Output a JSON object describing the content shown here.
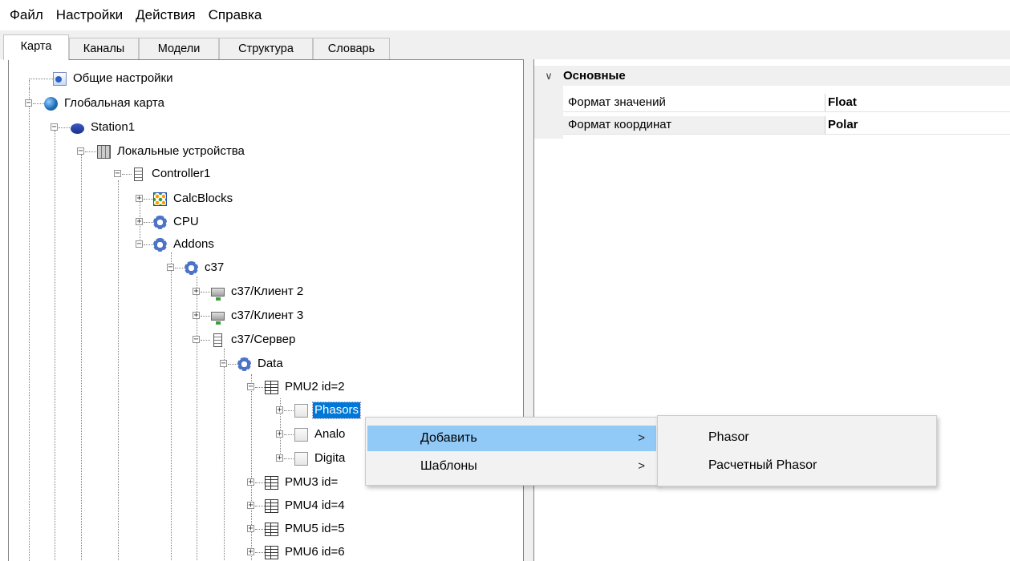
{
  "menubar": {
    "items": [
      "Файл",
      "Настройки",
      "Действия",
      "Справка"
    ]
  },
  "tabs": [
    "Карта",
    "Каналы",
    "Модели",
    "Структура",
    "Словарь"
  ],
  "tree": {
    "general_settings": "Общие настройки",
    "global_map": "Глобальная карта",
    "station1": "Station1",
    "local_devices": "Локальные устройства",
    "controller1": "Controller1",
    "calcblocks": "CalcBlocks",
    "cpu": "CPU",
    "addons": "Addons",
    "c37": "c37",
    "client2": "c37/Клиент 2",
    "client3": "c37/Клиент 3",
    "server": "c37/Сервер",
    "data": "Data",
    "pmu2": "PMU2 id=2",
    "phasors": "Phasors",
    "analog": "Analo",
    "digital": "Digita",
    "pmu3": "PMU3 id=",
    "pmu4": "PMU4 id=4",
    "pmu5": "PMU5 id=5",
    "pmu6": "PMU6 id=6"
  },
  "properties": {
    "category": "Основные",
    "rows": [
      {
        "name": "Формат значений",
        "value": "Float"
      },
      {
        "name": "Формат координат",
        "value": "Polar"
      }
    ]
  },
  "context_menu": {
    "items": [
      {
        "label": "Добавить",
        "arrow": ">"
      },
      {
        "label": "Шаблоны",
        "arrow": ">"
      }
    ]
  },
  "submenu": {
    "items": [
      "Phasor",
      "Расчетный Phasor"
    ]
  }
}
